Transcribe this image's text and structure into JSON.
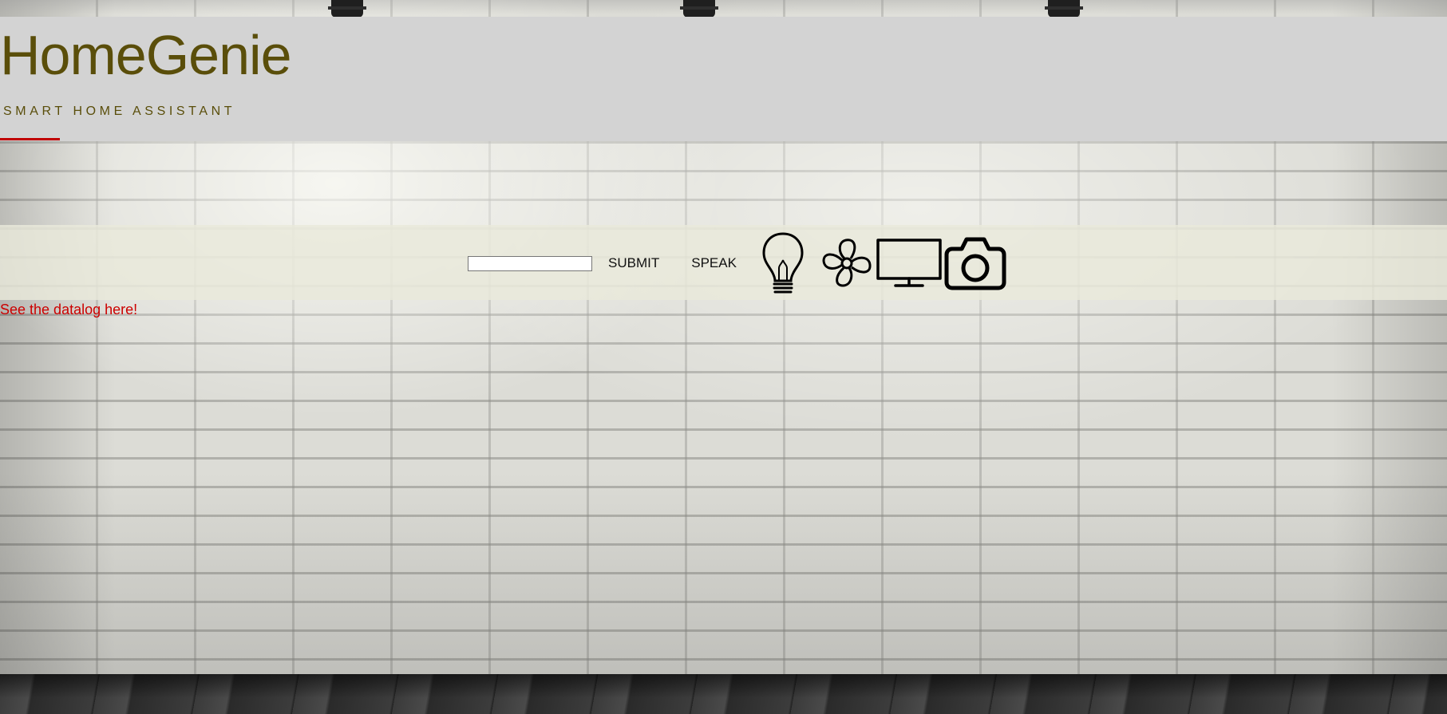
{
  "header": {
    "title": "HomeGenie",
    "tagline": "SMART HOME ASSISTANT"
  },
  "controls": {
    "command_input": {
      "value": "",
      "placeholder": ""
    },
    "submit_label": "SUBMIT",
    "speak_label": "SPEAK",
    "devices": [
      {
        "name": "light",
        "icon": "lightbulb-icon"
      },
      {
        "name": "fan",
        "icon": "fan-icon"
      },
      {
        "name": "tv",
        "icon": "tv-monitor-icon"
      },
      {
        "name": "camera",
        "icon": "camera-icon"
      }
    ]
  },
  "links": {
    "datalog": "See the datalog here!"
  },
  "colors": {
    "title": "#5a4e0a",
    "header_bg": "#d3d3d3",
    "accent": "#c00000",
    "link": "#cc0000"
  }
}
